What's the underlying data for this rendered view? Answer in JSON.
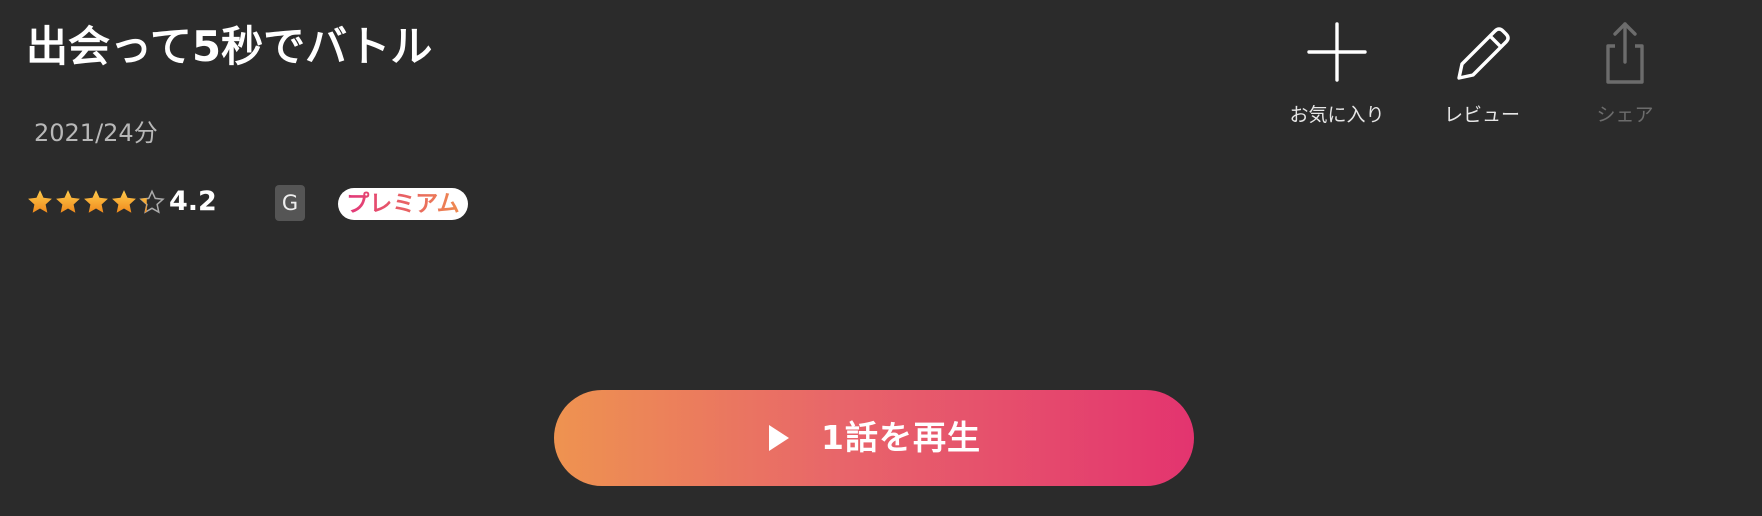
{
  "title": "出会って5秒でバトル",
  "meta": "2021/24分",
  "rating": {
    "value": "4.2",
    "stars": 4.2,
    "max_stars": 5,
    "star_color": "#f2a33a"
  },
  "age_rating": "G",
  "premium_label": "プレミアム",
  "actions": {
    "favorite": {
      "label": "お気に入り",
      "icon": "plus-icon"
    },
    "review": {
      "label": "レビュー",
      "icon": "pencil-icon"
    },
    "share": {
      "label": "シェア",
      "icon": "share-icon",
      "enabled": false
    }
  },
  "play_button": {
    "label": "1話を再生",
    "icon": "play-icon"
  },
  "colors": {
    "background": "#2b2b2b",
    "gradient_start": "#ee9350",
    "gradient_end": "#e3346f"
  }
}
